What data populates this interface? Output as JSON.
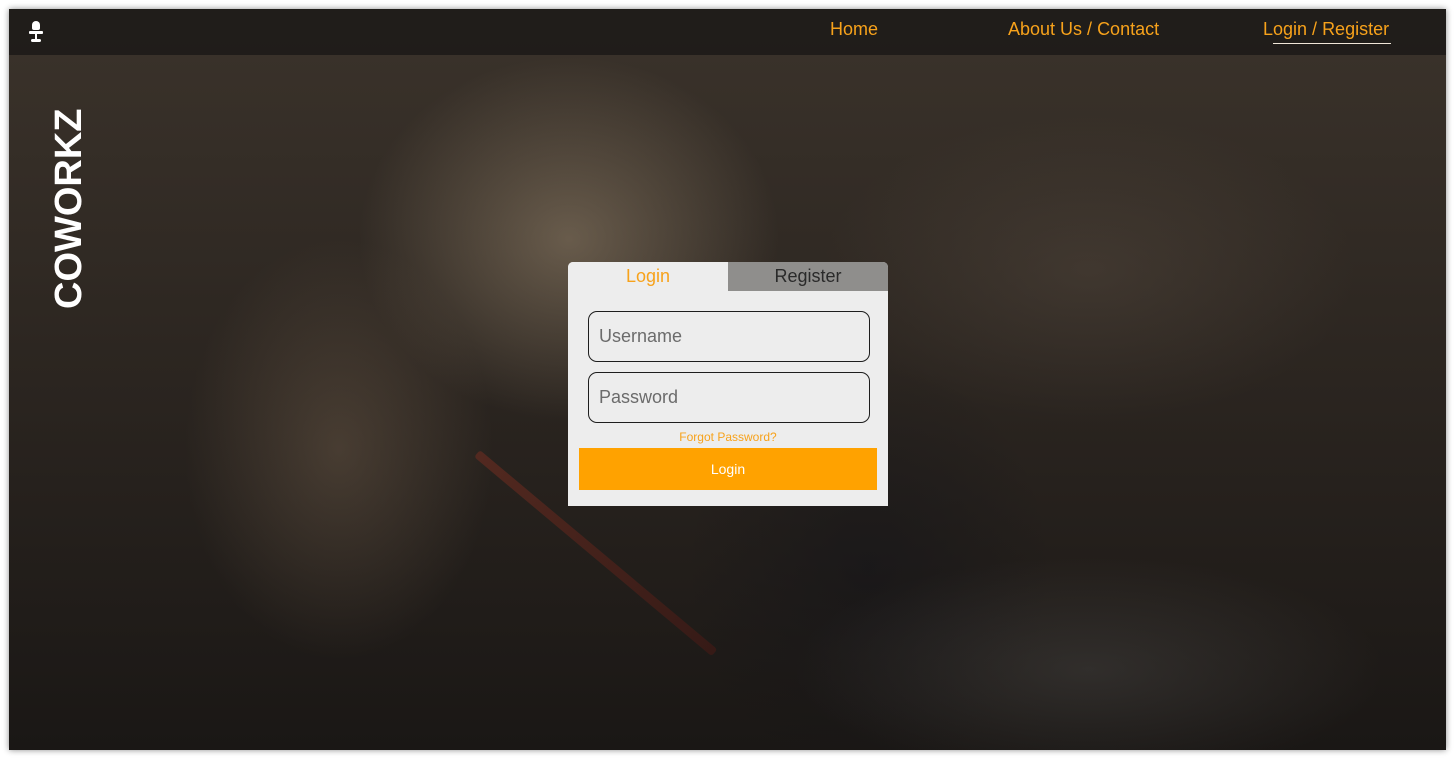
{
  "app": {
    "brand": "COWORKZ"
  },
  "nav": {
    "home": "Home",
    "about": "About Us",
    "separator": "/",
    "contact": "Contact",
    "login": "Login",
    "register": "Register"
  },
  "form": {
    "tabs": {
      "login": "Login",
      "register": "Register"
    },
    "username_placeholder": "Username",
    "password_placeholder": "Password",
    "forgot": "Forgot Password?",
    "submit": "Login"
  },
  "colors": {
    "accent": "#f7a21b",
    "button": "#ffa200",
    "card": "#ededed"
  }
}
